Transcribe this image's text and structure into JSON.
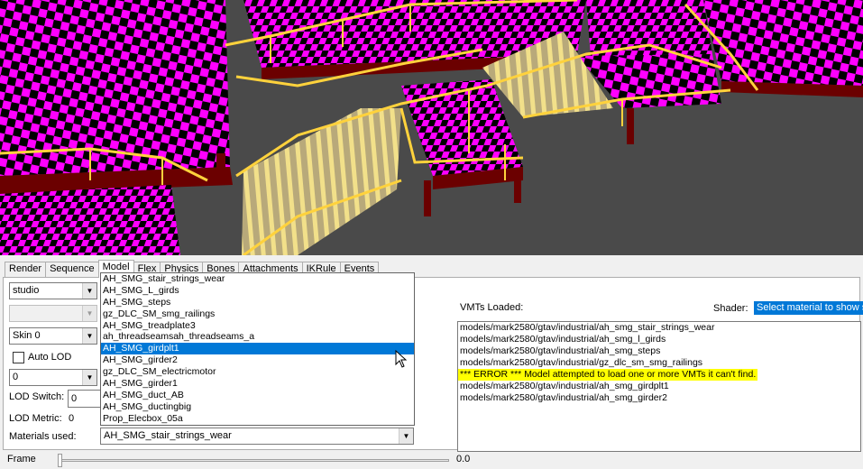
{
  "tabs": [
    "Render",
    "Sequence",
    "Model",
    "Flex",
    "Physics",
    "Bones",
    "Attachments",
    "IKRule",
    "Events"
  ],
  "active_tab": "Model",
  "left_controls": {
    "body_combo": "studio",
    "disabled_combo": "",
    "skin_combo": "Skin 0",
    "auto_lod_label": "Auto LOD",
    "lod_combo": "0",
    "lod_switch_label": "LOD Switch:",
    "lod_switch_value": "0",
    "lod_metric_label": "LOD Metric:",
    "lod_metric_value": "0"
  },
  "materials": {
    "label": "Materials used:",
    "selected_value": "AH_SMG_stair_strings_wear",
    "dropdown_items": [
      "AH_SMG_stair_strings_wear",
      "AH_SMG_L_girds",
      "AH_SMG_steps",
      "gz_DLC_SM_smg_railings",
      "AH_SMG_treadplate3",
      "ah_threadseamsah_threadseams_a",
      "AH_SMG_girdplt1",
      "AH_SMG_girder2",
      "gz_DLC_SM_electricmotor",
      "AH_SMG_girder1",
      "AH_SMG_duct_AB",
      "AH_SMG_ductingbig",
      "Prop_Elecbox_05a"
    ],
    "highlighted_item": "AH_SMG_girdplt1"
  },
  "vmts": {
    "label": "VMTs Loaded:",
    "shader_label": "Shader:",
    "shader_value": "Select material to show s",
    "lines": [
      "models/mark2580/gtav/industrial/ah_smg_stair_strings_wear",
      "models/mark2580/gtav/industrial/ah_smg_l_girds",
      "models/mark2580/gtav/industrial/ah_smg_steps",
      "models/mark2580/gtav/industrial/gz_dlc_sm_smg_railings",
      "*** ERROR *** Model attempted to load one or more VMTs it can't find.",
      "models/mark2580/gtav/industrial/ah_smg_girdplt1",
      "models/mark2580/gtav/industrial/ah_smg_girder2"
    ],
    "error_line_index": 4
  },
  "frame": {
    "label": "Frame",
    "value": "0.0",
    "position": 0
  },
  "colors": {
    "checker_a": "#ff00ff",
    "checker_b": "#000000",
    "railing": "#ffd23c",
    "support": "#6b0000",
    "floor": "#4a4a4a",
    "selection": "#0078d7",
    "error_highlight": "#ffff00"
  }
}
